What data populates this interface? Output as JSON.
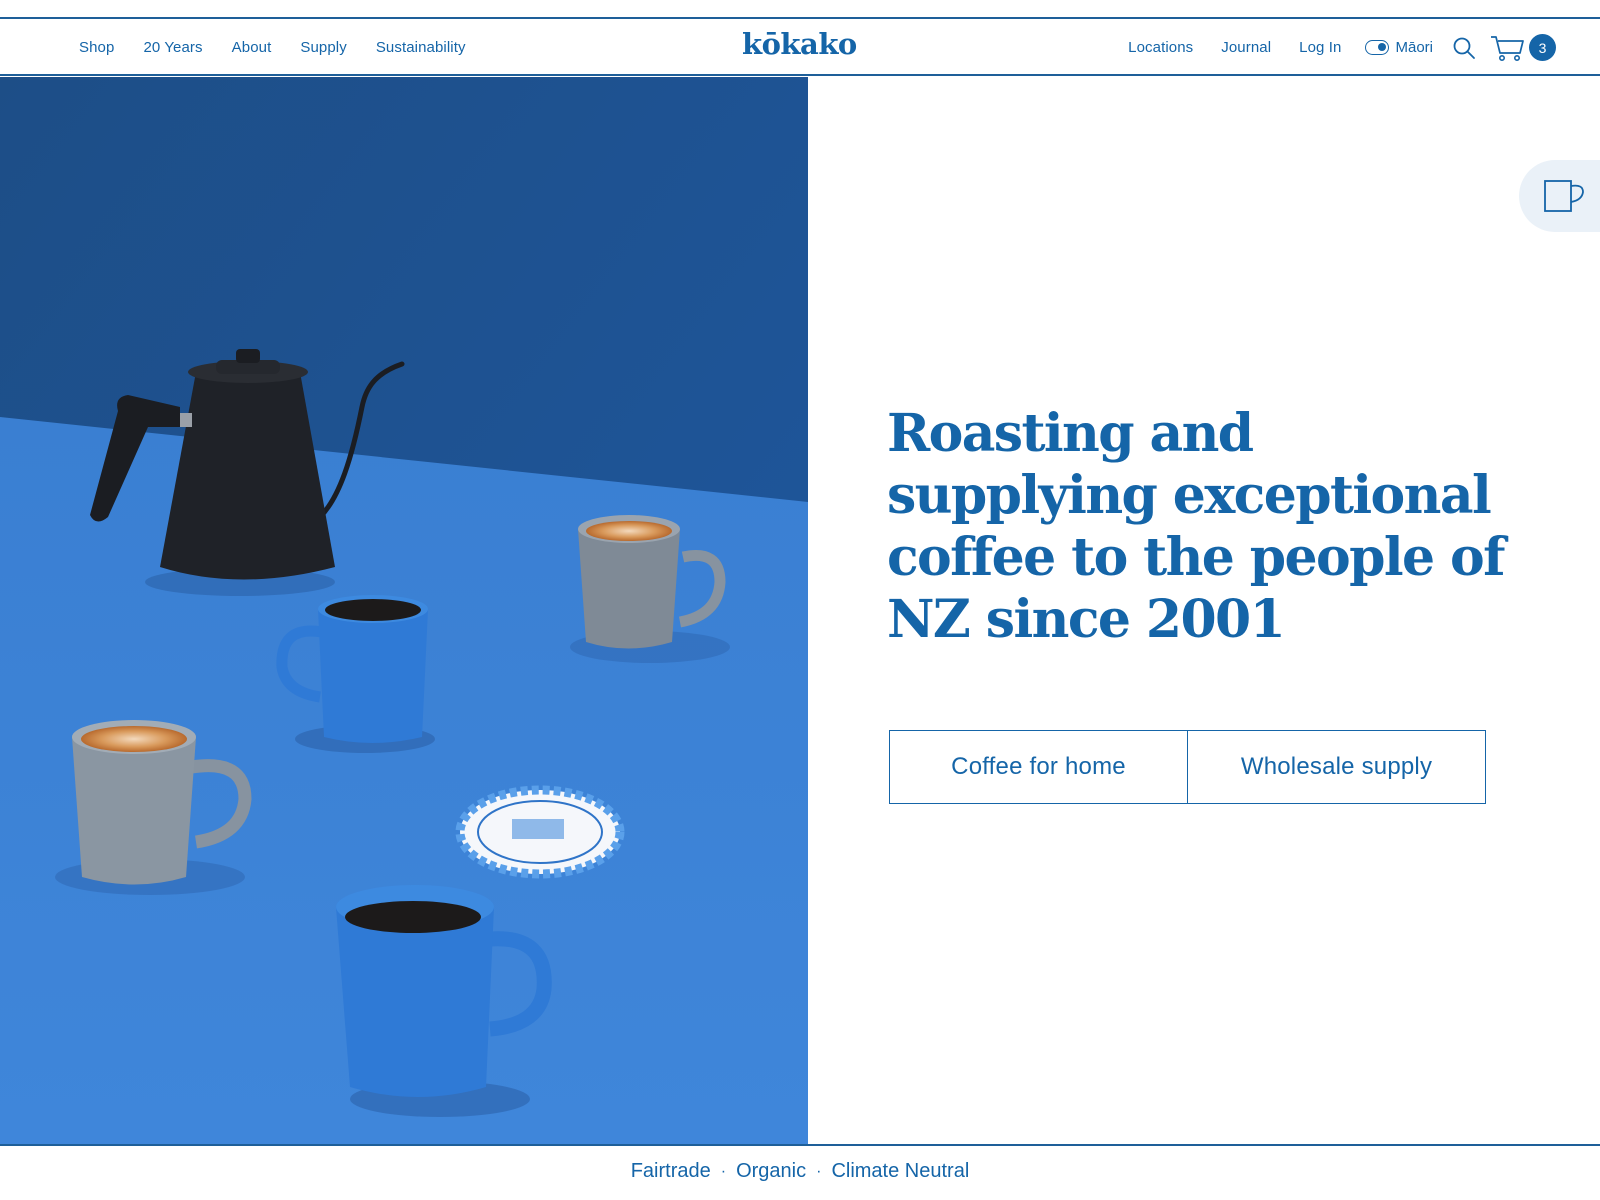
{
  "header": {
    "logo": "kōkako",
    "nav_left": [
      "Shop",
      "20 Years",
      "About",
      "Supply",
      "Sustainability"
    ],
    "nav_right": [
      "Locations",
      "Journal",
      "Log In"
    ],
    "language_label": "Māori",
    "cart_count": "3"
  },
  "hero": {
    "headline": "Roasting and supplying exceptional coffee to the people of NZ since 2001",
    "cta_primary": "Coffee for home",
    "cta_secondary": "Wholesale supply"
  },
  "footer_strip": {
    "items": [
      "Fairtrade",
      "Organic",
      "Climate Neutral"
    ],
    "separator": "·"
  },
  "colors": {
    "brand_blue": "#1565a8",
    "wall_blue": "#1f4f8a",
    "table_blue": "#3c82d6"
  }
}
